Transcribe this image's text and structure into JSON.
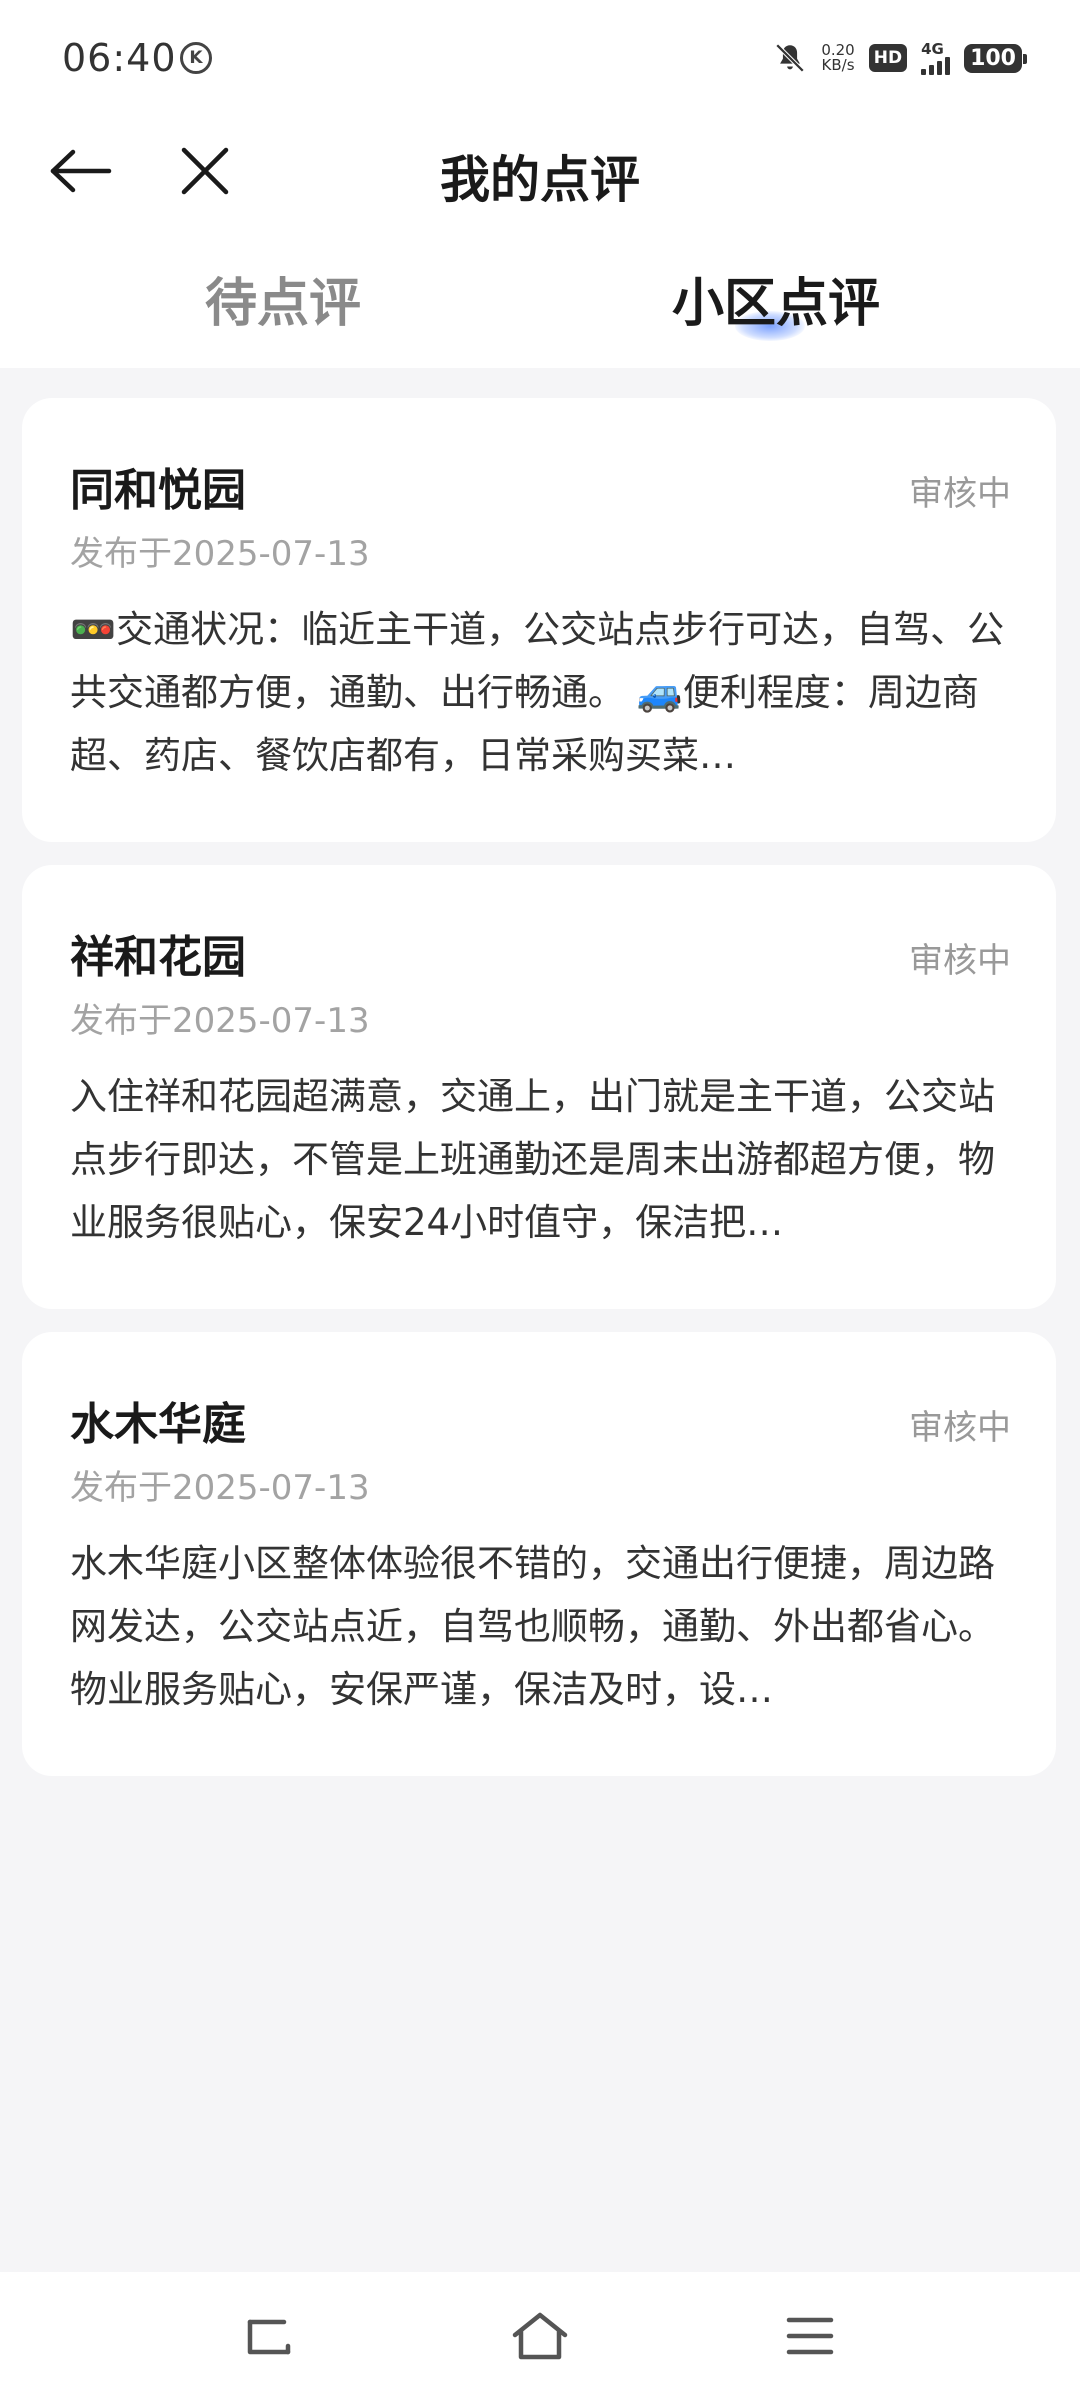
{
  "status_bar": {
    "time": "06:40",
    "k_badge": "K",
    "speed_value": "0.20",
    "speed_unit": "KB/s",
    "hd": "HD",
    "network": "4G",
    "battery": "100"
  },
  "header": {
    "title": "我的点评"
  },
  "tabs": [
    {
      "label": "待点评",
      "active": false
    },
    {
      "label": "小区点评",
      "active": true
    }
  ],
  "reviews": [
    {
      "name": "同和悦园",
      "status": "审核中",
      "date": "发布于2025-07-13",
      "content": "🚥交通状况：临近主干道，公交站点步行可达，自驾、公共交通都方便，通勤、出行畅通。 🚙便利程度：周边商超、药店、餐饮店都有，日常采购买菜…"
    },
    {
      "name": "祥和花园",
      "status": "审核中",
      "date": "发布于2025-07-13",
      "content": "入住祥和花园超满意，交通上，出门就是主干道，公交站点步行即达，不管是上班通勤还是周末出游都超方便，物业服务很贴心，保安24小时值守，保洁把…"
    },
    {
      "name": "水木华庭",
      "status": "审核中",
      "date": "发布于2025-07-13",
      "content": "水木华庭小区整体体验很不错的，交通出行便捷，周边路网发达，公交站点近，自驾也顺畅，通勤、外出都省心。物业服务贴心，安保严谨，保洁及时，设…"
    }
  ],
  "colors": {
    "background": "#f5f5f7",
    "card": "#ffffff",
    "active_tab": "#1a1a1a",
    "inactive_tab": "#8a8a8a",
    "indicator": "#5082ff",
    "status_text": "#999999"
  }
}
